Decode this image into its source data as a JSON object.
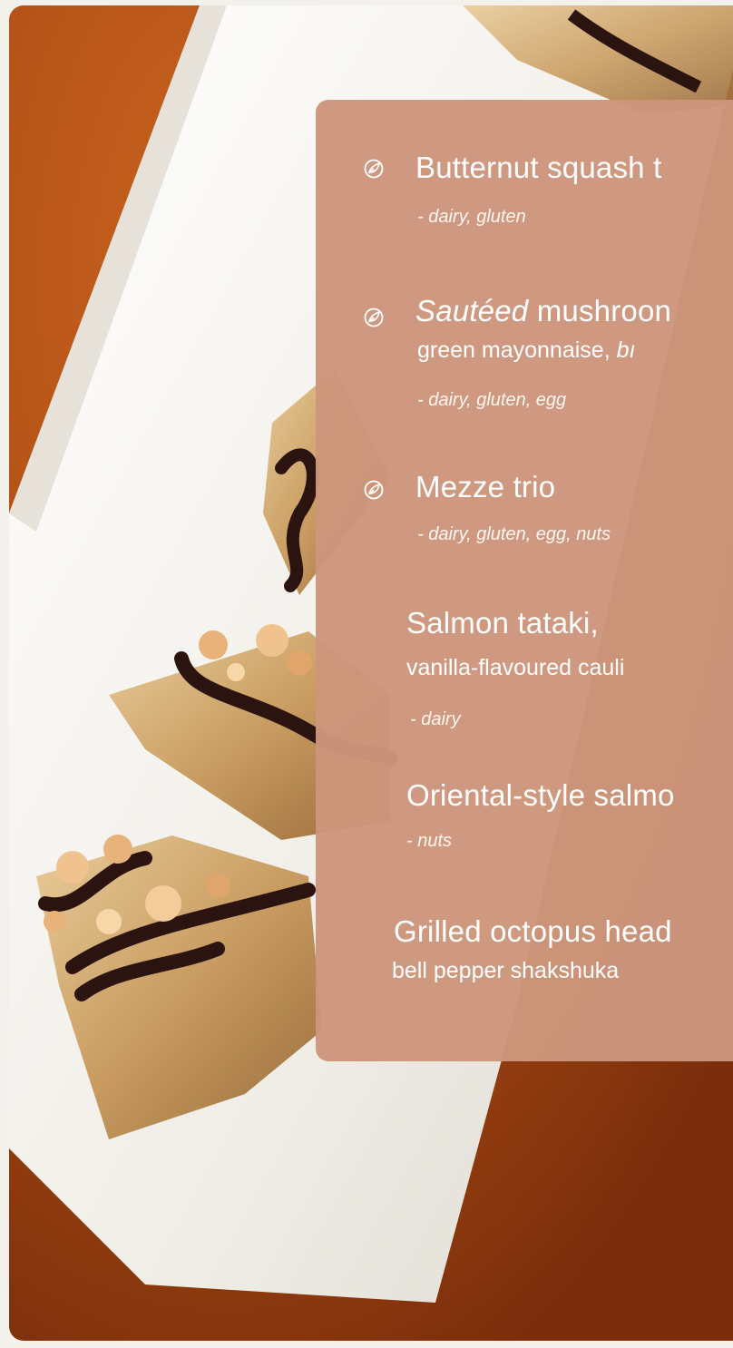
{
  "menu": {
    "items": [
      {
        "icon": "vegetarian-leaf-icon",
        "title": "Butternut squash t",
        "allergens": "- dairy, gluten"
      },
      {
        "icon": "vegetarian-leaf-icon",
        "title_italic": "Sautéed",
        "title_rest": " mushroon",
        "subtitle_plain": "green mayonnaise, ",
        "subtitle_italic": "bı",
        "allergens": "- dairy, gluten, egg"
      },
      {
        "icon": "vegetarian-leaf-icon",
        "title": "Mezze trio",
        "allergens": "- dairy, gluten, egg, nuts"
      },
      {
        "title": "Salmon tataki,",
        "subtitle": "vanilla-flavoured cauli",
        "allergens": "- dairy"
      },
      {
        "title": "Oriental-style salmo",
        "allergens": "- nuts"
      },
      {
        "title": "Grilled octopus head",
        "subtitle": "bell pepper shakshuka"
      }
    ]
  },
  "colors": {
    "card_background": "#cc967c",
    "text": "#ffffff",
    "table_orange": "#b8531c",
    "plate_white": "#f2f0ea"
  }
}
